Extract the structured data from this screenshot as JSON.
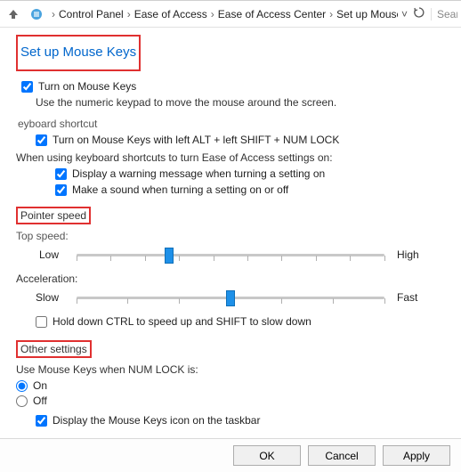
{
  "nav": {
    "crumbs": [
      "Control Panel",
      "Ease of Access",
      "Ease of Access Center",
      "Set up Mouse Keys"
    ],
    "search_placeholder": "Search Control Panel"
  },
  "page": {
    "title": "Set up Mouse Keys"
  },
  "turn_on": {
    "label": "Turn on Mouse Keys",
    "checked": true,
    "helper": "Use the numeric keypad to move the mouse around the screen."
  },
  "keyboard_shortcut": {
    "title_cutoff": "eyboard shortcut",
    "enable": {
      "label": "Turn on Mouse Keys with left ALT + left SHIFT + NUM LOCK",
      "checked": true
    },
    "when_using": "When using keyboard shortcuts to turn Ease of Access settings on:",
    "warn": {
      "label": "Display a warning message when turning a setting on",
      "checked": true
    },
    "sound": {
      "label": "Make a sound when turning a setting on or off",
      "checked": true
    }
  },
  "pointer_speed": {
    "title": "Pointer speed",
    "top_speed": {
      "label_cutoff": "Top speed:",
      "low": "Low",
      "high": "High",
      "value": 30
    },
    "accel": {
      "label": "Acceleration:",
      "slow": "Slow",
      "fast": "Fast",
      "value": 50
    },
    "hold_ctrl": {
      "label": "Hold down CTRL to speed up and SHIFT to slow down",
      "checked": false
    }
  },
  "other": {
    "title": "Other settings",
    "use_when": "Use Mouse Keys when NUM LOCK is:",
    "on": "On",
    "off": "Off",
    "selected": "on",
    "display_icon": {
      "label": "Display the Mouse Keys icon on the taskbar",
      "checked": true
    }
  },
  "footer": {
    "ok": "OK",
    "cancel": "Cancel",
    "apply": "Apply"
  }
}
